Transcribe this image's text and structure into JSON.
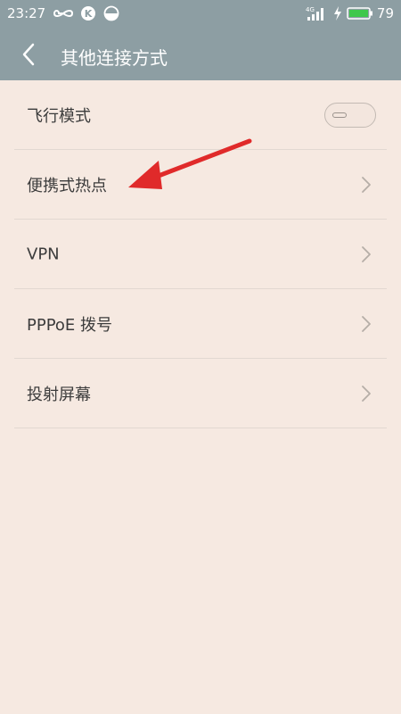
{
  "status_bar": {
    "time": "23:27",
    "battery": "79",
    "network": "4G"
  },
  "header": {
    "title": "其他连接方式"
  },
  "settings": [
    {
      "label": "飞行模式",
      "control": "toggle",
      "toggle_on": false
    },
    {
      "label": "便携式热点",
      "control": "chevron"
    },
    {
      "label": "VPN",
      "control": "chevron"
    },
    {
      "label": "PPPoE 拨号",
      "control": "chevron"
    },
    {
      "label": "投射屏幕",
      "control": "chevron"
    }
  ],
  "colors": {
    "app_bar": "#8d9ea3",
    "background": "#f6e9e1",
    "annotation_arrow": "#e02a2a"
  }
}
